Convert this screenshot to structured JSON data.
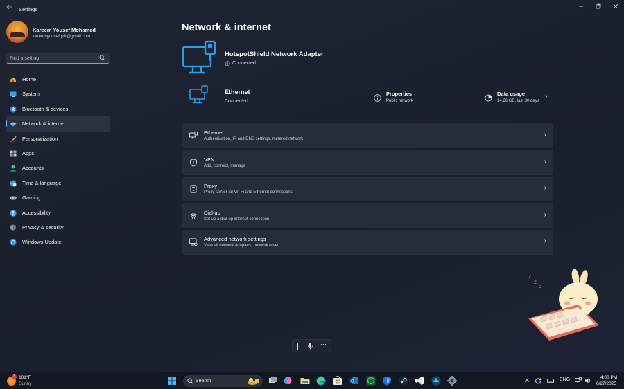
{
  "window": {
    "app_title": "Settings",
    "back_icon": "arrow-left-icon",
    "controls": [
      "minimize-icon",
      "restore-icon",
      "close-icon"
    ]
  },
  "profile": {
    "name": "Kareem Yousef Mohamed",
    "email": "kareemyousefquit@gmail.com"
  },
  "search": {
    "placeholder": "Find a setting",
    "icon": "search-icon"
  },
  "nav": {
    "active_color": "#4cc2ff",
    "items": [
      {
        "label": "Home",
        "icon": "home-icon"
      },
      {
        "label": "System",
        "icon": "monitor-icon"
      },
      {
        "label": "Bluetooth & devices",
        "icon": "bluetooth-icon"
      },
      {
        "label": "Network & internet",
        "icon": "wifi-icon",
        "active": true
      },
      {
        "label": "Personalization",
        "icon": "brush-icon"
      },
      {
        "label": "Apps",
        "icon": "apps-icon"
      },
      {
        "label": "Accounts",
        "icon": "person-icon"
      },
      {
        "label": "Time & language",
        "icon": "globe-clock-icon"
      },
      {
        "label": "Gaming",
        "icon": "gamepad-icon"
      },
      {
        "label": "Accessibility",
        "icon": "accessibility-icon"
      },
      {
        "label": "Privacy & security",
        "icon": "shield-icon"
      },
      {
        "label": "Windows Update",
        "icon": "update-icon"
      }
    ]
  },
  "main": {
    "title": "Network & internet",
    "adapter": {
      "name": "HotspotShield Network Adapter",
      "status": "Connected",
      "icon": "ethernet-monitor-icon"
    },
    "ethernet": {
      "name": "Ethernet",
      "status": "Connected",
      "icon": "ethernet-monitor-icon"
    },
    "properties": {
      "title": "Properties",
      "subtitle": "Public network",
      "icon": "info-icon"
    },
    "data_usage": {
      "title": "Data usage",
      "subtitle": "14.26 GB, last 30 days",
      "icon": "data-usage-icon"
    },
    "cards": [
      {
        "title": "Ethernet",
        "subtitle": "Authentication, IP and DNS settings, metered network",
        "icon": "ethernet-icon"
      },
      {
        "title": "VPN",
        "subtitle": "Add, connect, manage",
        "icon": "vpn-shield-icon"
      },
      {
        "title": "Proxy",
        "subtitle": "Proxy server for Wi-Fi and Ethernet connections",
        "icon": "proxy-icon"
      },
      {
        "title": "Dial-up",
        "subtitle": "Set up a dial-up internet connection",
        "icon": "dialup-icon"
      },
      {
        "title": "Advanced network settings",
        "subtitle": "View all network adapters, network reset",
        "icon": "advanced-network-icon"
      }
    ]
  },
  "voice_toolbar": {
    "icons": [
      "text-cursor-icon",
      "microphone-icon",
      "more-icon"
    ],
    "more_label": "···"
  },
  "taskbar": {
    "weather": {
      "temp": "101°F",
      "desc": "Sunny",
      "badge": "3"
    },
    "search_label": "Search",
    "apps": [
      "file-explorer-tasks-icon",
      "copilot-icon",
      "folder-icon",
      "edge-icon",
      "store-icon",
      "outlook-icon",
      "xbox-icon",
      "shield-icon",
      "steam-icon",
      "vscode-icon",
      "hotspot-icon",
      "settings-gear-icon"
    ],
    "tray": {
      "language": "ENG",
      "icons": [
        "chevron-up-icon",
        "sync-icon",
        "keyboard-icon",
        "network-icon",
        "volume-icon"
      ]
    },
    "clock": {
      "time": "4:00 PM",
      "date": "6/27/2025"
    }
  },
  "colors": {
    "accent": "#4cc2ff",
    "adapter_icon": "#2f9be6",
    "card_bg": "#262c39",
    "taskbar_bg": "#131722"
  }
}
